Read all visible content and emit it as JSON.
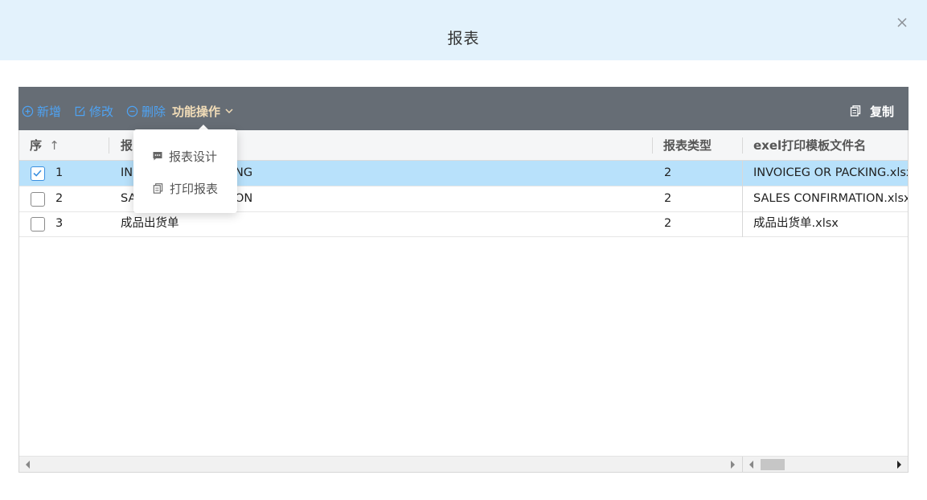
{
  "dialog": {
    "title": "报表"
  },
  "toolbar": {
    "add_label": "新增",
    "edit_label": "修改",
    "delete_label": "删除",
    "function_label": "功能操作",
    "copy_label": "复制"
  },
  "dropdown": {
    "items": [
      {
        "label": "报表设计",
        "icon": "comment-icon"
      },
      {
        "label": "打印报表",
        "icon": "print-icon"
      }
    ]
  },
  "grid": {
    "columns": {
      "seq": "序",
      "seq_sort": "↑",
      "name": "报",
      "type": "报表类型",
      "template": "exel打印模板文件名"
    },
    "rows": [
      {
        "seq": "1",
        "name": "IN",
        "name_tail": "NG",
        "type": "2",
        "template": "INVOICEG OR PACKING.xlsx",
        "checked": true
      },
      {
        "seq": "2",
        "name": "SA",
        "name_tail": "ON",
        "type": "2",
        "template": "SALES CONFIRMATION.xlsx",
        "checked": false
      },
      {
        "seq": "3",
        "name": "成品出货单",
        "name_tail": "",
        "type": "2",
        "template": "成品出货单.xlsx",
        "checked": false
      }
    ]
  },
  "colors": {
    "header_bg": "#e3f2fc",
    "toolbar_bg": "#666d75",
    "link_blue": "#4ea3f4",
    "selected_row": "#b8e1fb"
  }
}
